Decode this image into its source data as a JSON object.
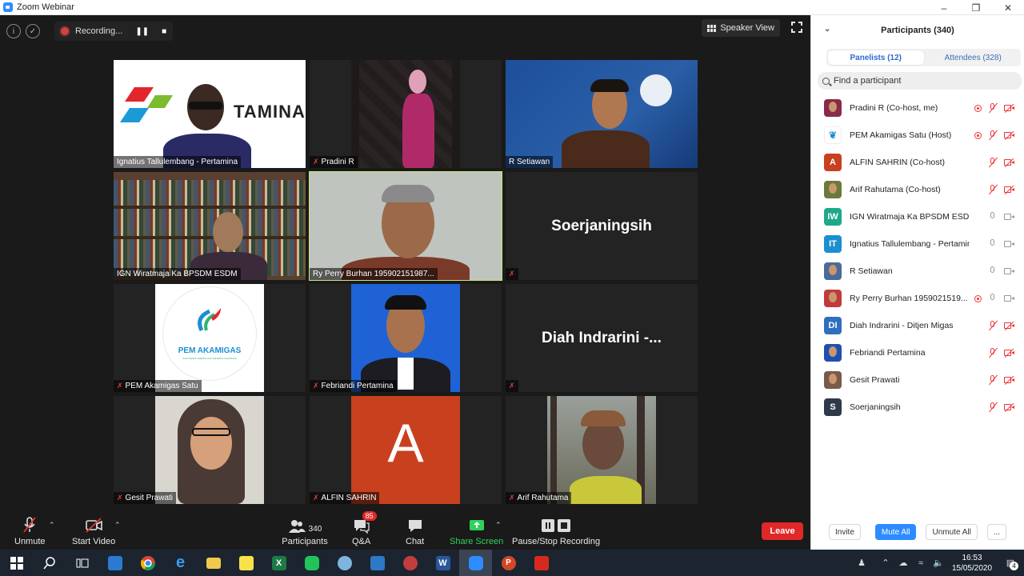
{
  "window": {
    "title": "Zoom Webinar"
  },
  "topbar": {
    "recording_label": "Recording...",
    "speaker_view_label": "Speaker View"
  },
  "tiles": [
    {
      "name": "Ignatius Tallulembang - Pertamina",
      "muted": false,
      "content": "pertamina"
    },
    {
      "name": "Pradini R",
      "muted": true,
      "content": "pradini"
    },
    {
      "name": "R Setiawan",
      "muted": false,
      "content": "setiawan"
    },
    {
      "name": "IGN Wiratmaja Ka BPSDM ESDM",
      "muted": false,
      "content": "wiratmaja"
    },
    {
      "name": "Ry Perry Burhan 195902151987...",
      "muted": false,
      "content": "perry",
      "active": true
    },
    {
      "name": "",
      "muted": true,
      "content": "text",
      "big": "Soerjaningsih"
    },
    {
      "name": "PEM Akamigas Satu",
      "muted": true,
      "content": "pem"
    },
    {
      "name": "Febriandi Pertamina",
      "muted": true,
      "content": "febriandi"
    },
    {
      "name": "",
      "muted": true,
      "content": "text",
      "big": "Diah Indrarini -..."
    },
    {
      "name": "Gesit Prawati",
      "muted": true,
      "content": "gesit"
    },
    {
      "name": "ALFIN SAHRIN",
      "muted": true,
      "content": "alfin"
    },
    {
      "name": "Arif Rahutama",
      "muted": true,
      "content": "arif"
    }
  ],
  "brand": {
    "pertamina": "TAMINA",
    "pem_title": "PEM AKAMIGAS",
    "pem_sub": "POLITEKNIK ENERGI DAN MINERAL AKAMIGAS",
    "alfin_letter": "A"
  },
  "toolbar": {
    "unmute": "Unmute",
    "start_video": "Start Video",
    "participants": "Participants",
    "participants_count": "340",
    "qa": "Q&A",
    "qa_badge": "85",
    "chat": "Chat",
    "share": "Share Screen",
    "record": "Pause/Stop Recording",
    "leave": "Leave"
  },
  "panel": {
    "title": "Participants (340)",
    "tab_panelists": "Panelists (12)",
    "tab_attendees": "Attendees (328)",
    "search_placeholder": "Find a participant",
    "participants": [
      {
        "name": "Pradini R (Co-host, me)",
        "avatar": "photo",
        "color": "#8a2a4a",
        "rec": true,
        "mic": "off",
        "cam": "off"
      },
      {
        "name": "PEM Akamigas Satu (Host)",
        "avatar": "logo",
        "color": "#ffffff",
        "rec": true,
        "mic": "off",
        "cam": "off"
      },
      {
        "name": "ALFIN SAHRIN (Co-host)",
        "avatar": "A",
        "color": "#c8401e",
        "rec": false,
        "mic": "off",
        "cam": "off"
      },
      {
        "name": "Arif Rahutama (Co-host)",
        "avatar": "photo",
        "color": "#6b7a3a",
        "rec": false,
        "mic": "off",
        "cam": "off"
      },
      {
        "name": "IGN Wiratmaja Ka BPSDM ESDM",
        "avatar": "IW",
        "color": "#1ea88a",
        "rec": false,
        "mic": "on",
        "cam": "on"
      },
      {
        "name": "Ignatius Tallulembang - Pertamina",
        "avatar": "IT",
        "color": "#1a8fd1",
        "rec": false,
        "mic": "on",
        "cam": "on"
      },
      {
        "name": "R Setiawan",
        "avatar": "photo",
        "color": "#4a6a9a",
        "rec": false,
        "mic": "on",
        "cam": "on"
      },
      {
        "name": "Ry Perry Burhan 1959021519...",
        "avatar": "photo",
        "color": "#c23a3a",
        "rec": true,
        "mic": "on",
        "cam": "on"
      },
      {
        "name": "Diah Indrarini - Ditjen Migas",
        "avatar": "DI",
        "color": "#2e6fc0",
        "rec": false,
        "mic": "off",
        "cam": "off"
      },
      {
        "name": "Febriandi Pertamina",
        "avatar": "photo",
        "color": "#1f4fb0",
        "rec": false,
        "mic": "off",
        "cam": "off"
      },
      {
        "name": "Gesit Prawati",
        "avatar": "photo",
        "color": "#7a5a4a",
        "rec": false,
        "mic": "off",
        "cam": "off"
      },
      {
        "name": "Soerjaningsih",
        "avatar": "S",
        "color": "#2d3a4a",
        "rec": false,
        "mic": "off",
        "cam": "off"
      }
    ],
    "invite": "Invite",
    "mute_all": "Mute All",
    "unmute_all": "Unmute All",
    "more": "..."
  },
  "taskbar": {
    "time": "16:53",
    "date": "15/05/2020",
    "notif_count": "4"
  }
}
